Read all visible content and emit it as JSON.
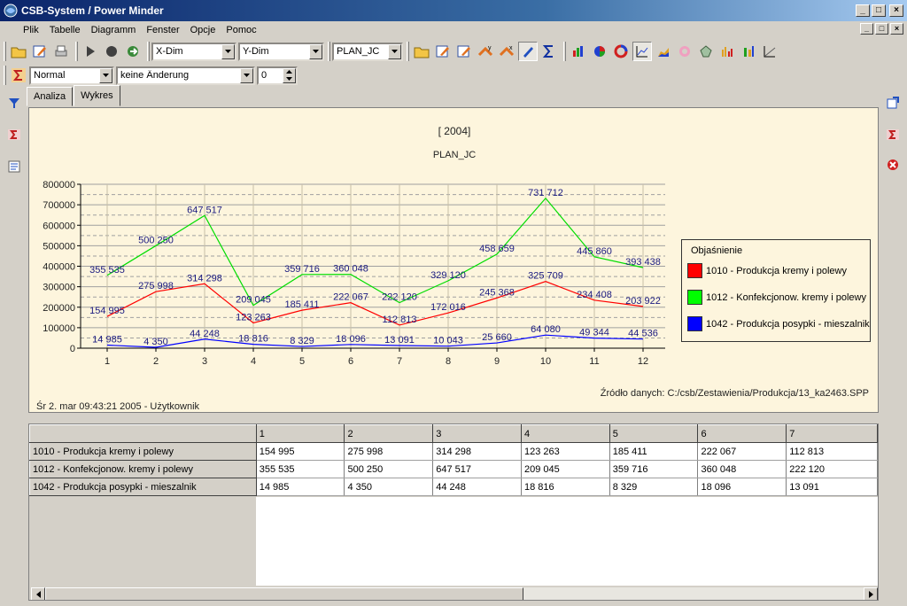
{
  "window": {
    "title": "CSB-System / Power Minder",
    "min_label": "_",
    "max_label": "□",
    "close_label": "×"
  },
  "menu": [
    "Plik",
    "Tabelle",
    "Diagramm",
    "Fenster",
    "Opcje",
    "Pomoc"
  ],
  "toolbar": {
    "xdim": "X-Dim",
    "ydim": "Y-Dim",
    "plan": "PLAN_JC",
    "mode": "Normal",
    "change": "keine Änderung",
    "number": "0"
  },
  "tabs": [
    "Analiza",
    "Wykres"
  ],
  "chart": {
    "title": "[ 2004]",
    "subtitle": "PLAN_JC",
    "legend_title": "Objaśnienie",
    "footer_left": "Śr 2. mar 09:43:21 2005 - Użytkownik",
    "footer_right": "Źródło danych: C:/csb/Zestawienia/Produkcja/13_ka2463.SPP"
  },
  "chart_data": {
    "type": "line",
    "x": [
      1,
      2,
      3,
      4,
      5,
      6,
      7,
      8,
      9,
      10,
      11,
      12
    ],
    "ylim": [
      0,
      800000
    ],
    "yticks": [
      "0",
      "100000",
      "200000",
      "300000",
      "400000",
      "500000",
      "600000",
      "700000",
      "800000"
    ],
    "grid": true,
    "legend_position": "right",
    "series": [
      {
        "name": "1010 - Produkcja kremy i polewy",
        "color": "#ff0000",
        "values": [
          154995,
          275998,
          314298,
          123263,
          185411,
          222067,
          112813,
          172016,
          245368,
          325709,
          234408,
          203922
        ],
        "labels": [
          "154 995",
          "275 998",
          "314 298",
          "123 263",
          "185 411",
          "222 067",
          "112 813",
          "172 016",
          "245 368",
          "325 709",
          "234 408",
          "203 922"
        ]
      },
      {
        "name": "1012 - Konfekcjonow. kremy i polewy",
        "color": "#00dd00",
        "values": [
          355535,
          500250,
          647517,
          209045,
          359716,
          360048,
          222120,
          329120,
          458659,
          731712,
          445860,
          393438
        ],
        "labels": [
          "355 535",
          "500 250",
          "647 517",
          "209 045",
          "359 716",
          "360 048",
          "222 120",
          "329 120",
          "458 659",
          "731 712",
          "445 860",
          "393 438"
        ]
      },
      {
        "name": "1042 - Produkcja posypki - mieszalnik",
        "color": "#0000ff",
        "values": [
          14985,
          4350,
          44248,
          18816,
          8329,
          18096,
          13091,
          10043,
          25660,
          64080,
          49344,
          44536
        ],
        "labels": [
          "14 985",
          "4 350",
          "44 248",
          "18 816",
          "8 329",
          "18 096",
          "13 091",
          "10 043",
          "25 660",
          "64 080",
          "49 344",
          "44 536"
        ]
      }
    ]
  },
  "grid": {
    "columns": [
      "1",
      "2",
      "3",
      "4",
      "5",
      "6",
      "7"
    ],
    "rows": [
      {
        "label": "1010 - Produkcja kremy i polewy",
        "cells": [
          "154 995",
          "275 998",
          "314 298",
          "123 263",
          "185 411",
          "222 067",
          "112 813"
        ]
      },
      {
        "label": "1012 - Konfekcjonow. kremy i polewy",
        "cells": [
          "355 535",
          "500 250",
          "647 517",
          "209 045",
          "359 716",
          "360 048",
          "222 120"
        ]
      },
      {
        "label": "1042 - Produkcja posypki - mieszalnik",
        "cells": [
          "14 985",
          "4 350",
          "44 248",
          "18 816",
          "8 329",
          "18 096",
          "13 091"
        ]
      }
    ]
  }
}
